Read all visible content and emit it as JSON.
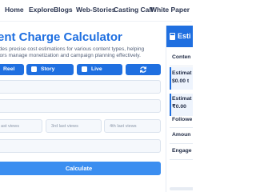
{
  "nav": {
    "items": [
      {
        "label": "Home"
      },
      {
        "label": "Explore"
      },
      {
        "label": "Blogs"
      },
      {
        "label": "Web-Stories"
      },
      {
        "label": "Casting Call"
      },
      {
        "label": "White Paper"
      }
    ]
  },
  "main": {
    "title": "tent Charge Calculator",
    "description_lines": [
      "vides precise cost estimations for various content types, helping",
      "ators manage monetization and campaign planning effectively."
    ],
    "content_types": [
      {
        "label": "Reel"
      },
      {
        "label": "Story"
      },
      {
        "label": "Live"
      }
    ],
    "fields": {
      "field1_placeholder": "",
      "field2_placeholder": "",
      "view1_placeholder": "ast views",
      "view3_placeholder": "3rd last views",
      "view4_placeholder": "4th last views",
      "field6_placeholder": ""
    },
    "calculate_label": "Calculate"
  },
  "panel": {
    "title": "Esti",
    "content_label": "Conten",
    "estimate1_label": "Estimat",
    "estimate1_value": "$0.00 t",
    "estimate2_label": "Estimat",
    "estimate2_value": "₹0.00",
    "followers_label": "Followe",
    "amount_label": "Amoun",
    "engagement_label": "Engage"
  },
  "colors": {
    "accent": "#1f6fe0",
    "button": "#3b8ef0",
    "field_bg": "#f5f8fc"
  }
}
